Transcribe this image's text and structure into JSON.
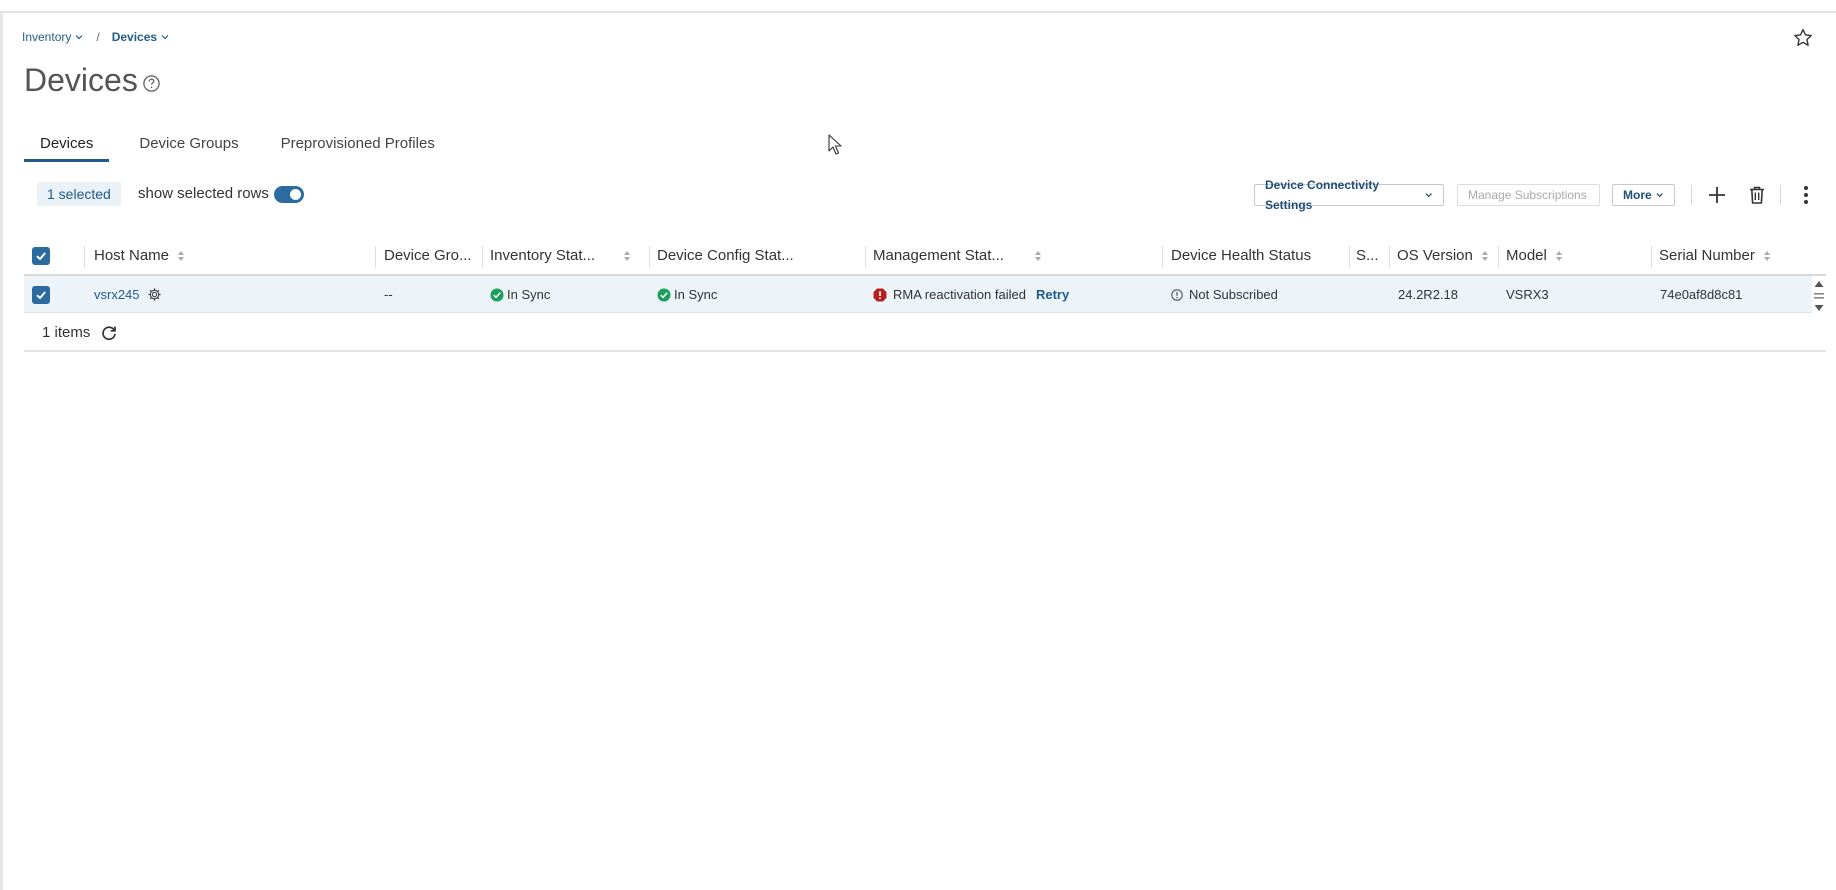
{
  "breadcrumb": {
    "items": [
      {
        "label": "Inventory"
      },
      {
        "label": "Devices"
      }
    ],
    "separator": "/"
  },
  "page": {
    "title": "Devices"
  },
  "tabs": [
    {
      "label": "Devices",
      "active": true
    },
    {
      "label": "Device Groups",
      "active": false
    },
    {
      "label": "Preprovisioned Profiles",
      "active": false
    }
  ],
  "toolbar": {
    "selected_count": "1 selected",
    "show_selected_label": "show selected rows",
    "show_selected_on": true,
    "connectivity_label": "Device Connectivity Settings",
    "manage_subscriptions_label": "Manage Subscriptions",
    "more_label": "More"
  },
  "table": {
    "columns": [
      {
        "label": "Host Name"
      },
      {
        "label": "Device Gro..."
      },
      {
        "label": "Inventory Stat..."
      },
      {
        "label": "Device Config Stat..."
      },
      {
        "label": "Management Stat..."
      },
      {
        "label": "Device Health Status"
      },
      {
        "label": "S..."
      },
      {
        "label": "OS Version"
      },
      {
        "label": "Model"
      },
      {
        "label": "Serial Number"
      }
    ],
    "rows": [
      {
        "selected": true,
        "host_name": "vsrx245",
        "device_group": "--",
        "inventory_status": "In Sync",
        "config_status": "In Sync",
        "management_status": "RMA reactivation failed",
        "management_action": "Retry",
        "health_status": "Not Subscribed",
        "os_version": "24.2R2.18",
        "model": "VSRX3",
        "serial_number": "74e0af8d8c81"
      }
    ],
    "footer_count": "1 items"
  },
  "colors": {
    "accent": "#1f5c8c",
    "ok": "#1aa05a",
    "error": "#b3201d",
    "row_selected": "#ecf3f9"
  }
}
